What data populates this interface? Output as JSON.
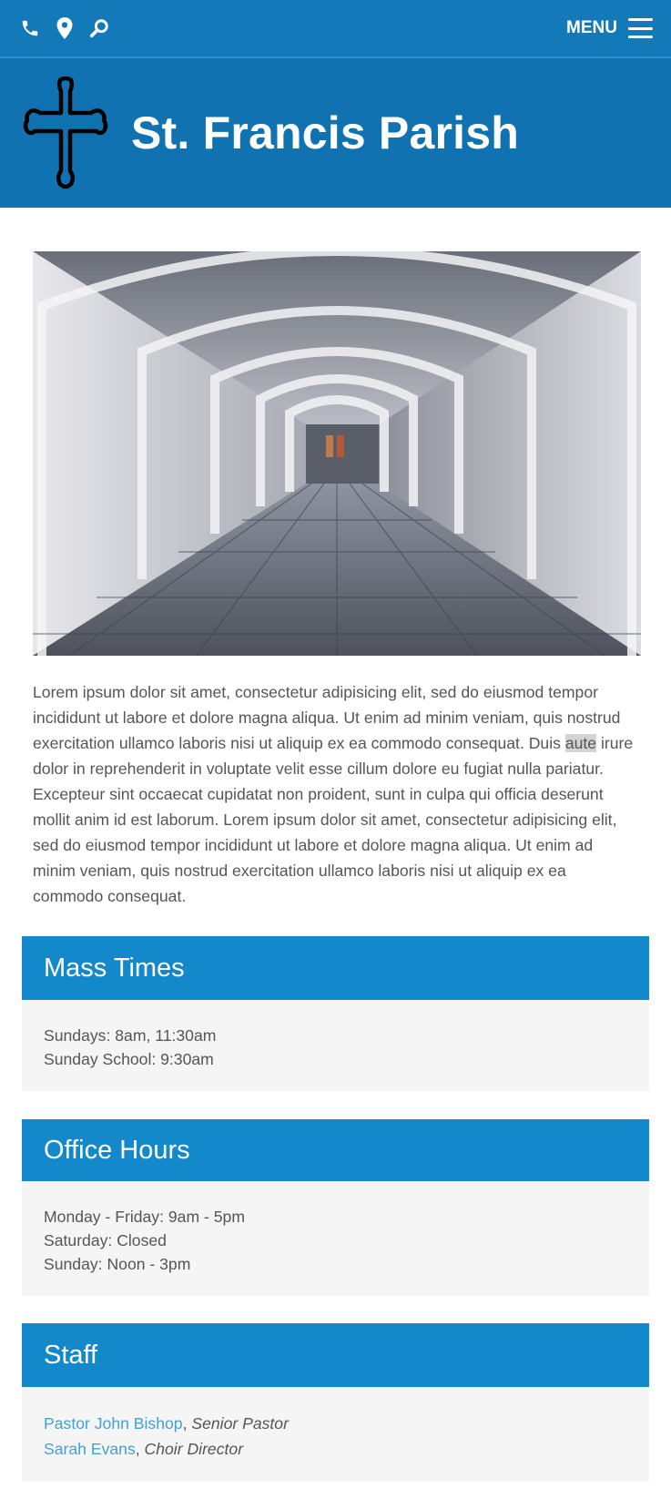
{
  "topbar": {
    "icons": [
      "phone-icon",
      "map-pin-icon",
      "search-icon"
    ],
    "menu_label": "MENU"
  },
  "brand": {
    "title": "St. Francis Parish",
    "logo_icon": "cross-icon"
  },
  "intro": {
    "before": "Lorem ipsum dolor sit amet, consectetur adipisicing elit, sed do eiusmod tempor incididunt ut labore et dolore magna aliqua. Ut enim ad minim veniam, quis nostrud exercitation ullamco laboris nisi ut aliquip ex ea commodo consequat. Duis ",
    "highlight": "aute",
    "after": " irure dolor in reprehenderit in voluptate velit esse cillum dolore eu fugiat nulla pariatur. Excepteur sint occaecat cupidatat non proident, sunt in culpa qui officia deserunt mollit anim id est laborum. Lorem ipsum dolor sit amet, consectetur adipisicing elit, sed do eiusmod tempor incididunt ut labore et dolore magna aliqua. Ut enim ad minim veniam, quis nostrud exercitation ullamco laboris nisi ut aliquip ex ea commodo consequat."
  },
  "mass_times": {
    "title": "Mass Times",
    "lines": [
      "Sundays: 8am, 11:30am",
      "Sunday School: 9:30am"
    ]
  },
  "office_hours": {
    "title": "Office Hours",
    "lines": [
      "Monday - Friday: 9am - 5pm",
      "Saturday: Closed",
      "Sunday: Noon - 3pm"
    ]
  },
  "staff": {
    "title": "Staff",
    "members": [
      {
        "name": "Pastor John Bishop",
        "sep": ", ",
        "role": "Senior Pastor"
      },
      {
        "name": "Sarah Evans",
        "sep": ", ",
        "role": "Choir Director"
      }
    ]
  },
  "colors": {
    "topbar": "#1479b8",
    "brand": "#1072b0",
    "panel_header": "#1388cb",
    "panel_body": "#f5f5f5",
    "link": "#42a2d8"
  }
}
